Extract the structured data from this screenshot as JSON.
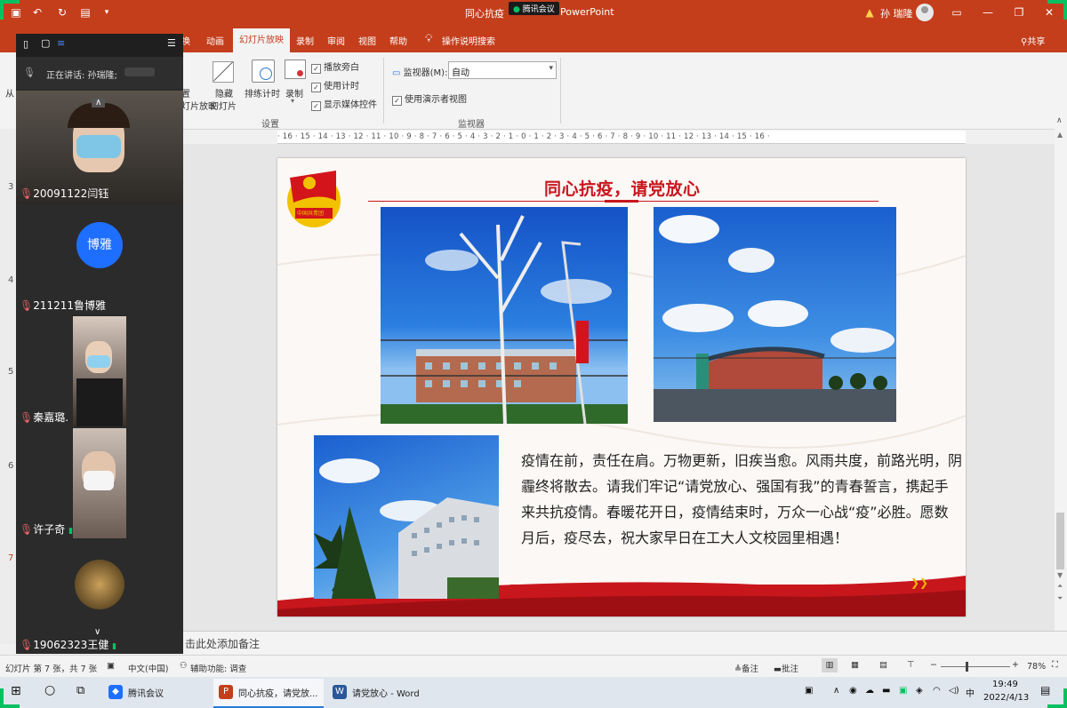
{
  "titlebar": {
    "title_left": "同心抗疫",
    "meeting_name": "腾讯会议",
    "title_right": "PowerPoint",
    "user_name": "孙 瑞隆"
  },
  "ribbon_tabs": [
    {
      "label": "换",
      "active": false
    },
    {
      "label": "动画",
      "active": false
    },
    {
      "label": "幻灯片放映",
      "active": true
    },
    {
      "label": "录制",
      "active": false
    },
    {
      "label": "审阅",
      "active": false
    },
    {
      "label": "视图",
      "active": false
    },
    {
      "label": "帮助",
      "active": false
    },
    {
      "label": "操作说明搜索",
      "active": false
    }
  ],
  "share_label": "共享",
  "ribbon": {
    "left_cut": "从",
    "set_show_1": "置",
    "set_show_2": "灯片放映",
    "hide_slide_1": "隐藏",
    "hide_slide_2": "幻灯片",
    "rehearse": "排练计时",
    "record": "录制",
    "checks": [
      {
        "label": "播放旁白",
        "checked": true
      },
      {
        "label": "使用计时",
        "checked": true
      },
      {
        "label": "显示媒体控件",
        "checked": true
      }
    ],
    "group_setup": "设置",
    "monitor_label": "监视器(M):",
    "monitor_value": "自动",
    "presenter_view": "使用演示者视图",
    "group_monitor": "监视器"
  },
  "ruler_text": "· 16 · 15 · 14 · 13 · 12 · 11 · 10 · 9 · 8 · 7 · 6 · 5 · 4 · 3 · 2 · 1 · 0 · 1 · 2 · 3 · 4 · 5 · 6 · 7 · 8 · 9 · 10 · 11 · 12 · 13 · 14 · 15 · 16 ·",
  "slide": {
    "title": "同心抗疫，请党放心",
    "body": "疫情在前，责任在肩。万物更新，旧疾当愈。风雨共度，前路光明，阴霾终将散去。请我们牢记“请党放心、强国有我”的青春誓言，携起手来共抗疫情。春暖花开日，疫情结束时，万众一心战“疫”必胜。愿数月后，疫尽去，祝大家早日在工大人文校园里相遇！",
    "emblem_text": "中国共青团"
  },
  "thumb_numbers": [
    "3",
    "4",
    "5",
    "6",
    "7"
  ],
  "notes_placeholder": "击此处添加备注",
  "status": {
    "slide_info": "幻灯片 第 7 张，共 7 张",
    "language": "中文(中国)",
    "accessibility": "辅助功能: 调查",
    "notes": "备注",
    "comments": "批注",
    "zoom": "78%"
  },
  "meeting": {
    "speaking_label": "正在讲话: 孙瑞隆;",
    "participants": [
      {
        "name": "20091122闫钰",
        "kind": "video"
      },
      {
        "name": "211211鲁博雅",
        "kind": "avatar",
        "avatar_text": "博雅"
      },
      {
        "name": "秦嘉璐.",
        "kind": "video"
      },
      {
        "name": "许子奇",
        "kind": "video"
      },
      {
        "name": "19062323王健",
        "kind": "video"
      }
    ]
  },
  "taskbar": {
    "apps": [
      {
        "label": "腾讯会议"
      },
      {
        "label": "同心抗疫，请党放..."
      },
      {
        "label": "请党放心 - Word"
      }
    ],
    "ime": "中",
    "time": "19:49",
    "date": "2022/4/13"
  },
  "colors": {
    "ppt_red": "#c43e1c",
    "slide_red": "#c8161d",
    "meeting_green": "#07c160",
    "avatar_blue": "#1e6fff"
  }
}
